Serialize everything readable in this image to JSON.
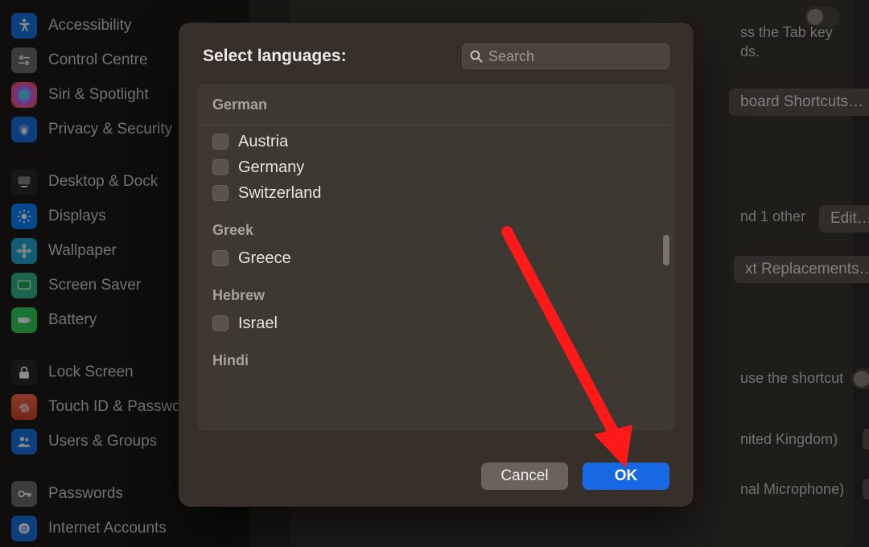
{
  "sidebar": {
    "groups": [
      [
        {
          "icon": "accessibility",
          "label": "Accessibility",
          "icon_class": "ic-blue"
        },
        {
          "icon": "control-centre",
          "label": "Control Centre",
          "icon_class": "ic-grey"
        },
        {
          "icon": "siri",
          "label": "Siri & Spotlight",
          "icon_class": "ic-siri"
        },
        {
          "icon": "privacy",
          "label": "Privacy & Security",
          "icon_class": "ic-hand"
        }
      ],
      [
        {
          "icon": "desktop-dock",
          "label": "Desktop & Dock",
          "icon_class": "ic-dark"
        },
        {
          "icon": "displays",
          "label": "Displays",
          "icon_class": "ic-sun"
        },
        {
          "icon": "wallpaper",
          "label": "Wallpaper",
          "icon_class": "ic-flower"
        },
        {
          "icon": "screen-saver",
          "label": "Screen Saver",
          "icon_class": "ic-saver"
        },
        {
          "icon": "battery",
          "label": "Battery",
          "icon_class": "ic-batt"
        }
      ],
      [
        {
          "icon": "lock-screen",
          "label": "Lock Screen",
          "icon_class": "ic-lock"
        },
        {
          "icon": "touch-id",
          "label": "Touch ID & Password",
          "icon_class": "ic-touch"
        },
        {
          "icon": "users",
          "label": "Users & Groups",
          "icon_class": "ic-users"
        }
      ],
      [
        {
          "icon": "passwords",
          "label": "Passwords",
          "icon_class": "ic-pass"
        },
        {
          "icon": "internet",
          "label": "Internet Accounts",
          "icon_class": "ic-net"
        }
      ]
    ]
  },
  "background": {
    "tab_line1": "ss the Tab key",
    "tab_line2": "ds.",
    "shortcuts_btn": "board Shortcuts…",
    "and_other": "nd 1 other",
    "edit_btn": "Edit…",
    "text_repl_btn": "xt Replacements…",
    "use_shortcut": "use the shortcut",
    "lang_row": "nited Kingdom)",
    "mic_row": "nal Microphone)"
  },
  "modal": {
    "title": "Select languages:",
    "search_placeholder": "Search",
    "groups": [
      {
        "name": "German",
        "items": [
          "Austria",
          "Germany",
          "Switzerland"
        ]
      },
      {
        "name": "Greek",
        "items": [
          "Greece"
        ]
      },
      {
        "name": "Hebrew",
        "items": [
          "Israel"
        ]
      },
      {
        "name": "Hindi",
        "items": []
      }
    ],
    "cancel": "Cancel",
    "ok": "OK"
  }
}
